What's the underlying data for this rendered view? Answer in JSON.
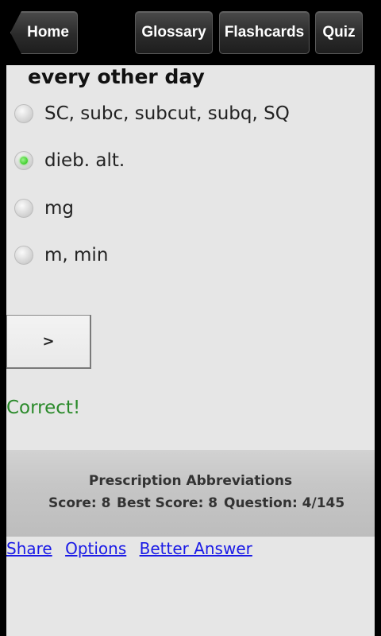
{
  "toolbar": {
    "home_label": "Home",
    "glossary_label": "Glossary",
    "flashcards_label": "Flashcards",
    "quiz_label": "Quiz"
  },
  "quiz": {
    "question": "every other day",
    "options": [
      {
        "label": "SC, subc, subcut, subq, SQ",
        "selected": false
      },
      {
        "label": "dieb. alt.",
        "selected": true
      },
      {
        "label": "mg",
        "selected": false
      },
      {
        "label": "m, min",
        "selected": false
      }
    ],
    "next_label": ">",
    "feedback": "Correct!",
    "feedback_color": "#2a8a2a"
  },
  "status": {
    "set_title": "Prescription Abbreviations",
    "score": "Score: 8",
    "best_score": "Best Score: 8",
    "question_counter": "Question: 4/145"
  },
  "links": {
    "share": "Share",
    "options": "Options",
    "better_answer": "Better Answer"
  },
  "colors": {
    "accent_selected": "#3ecf2a",
    "link": "#1a1ae6"
  }
}
